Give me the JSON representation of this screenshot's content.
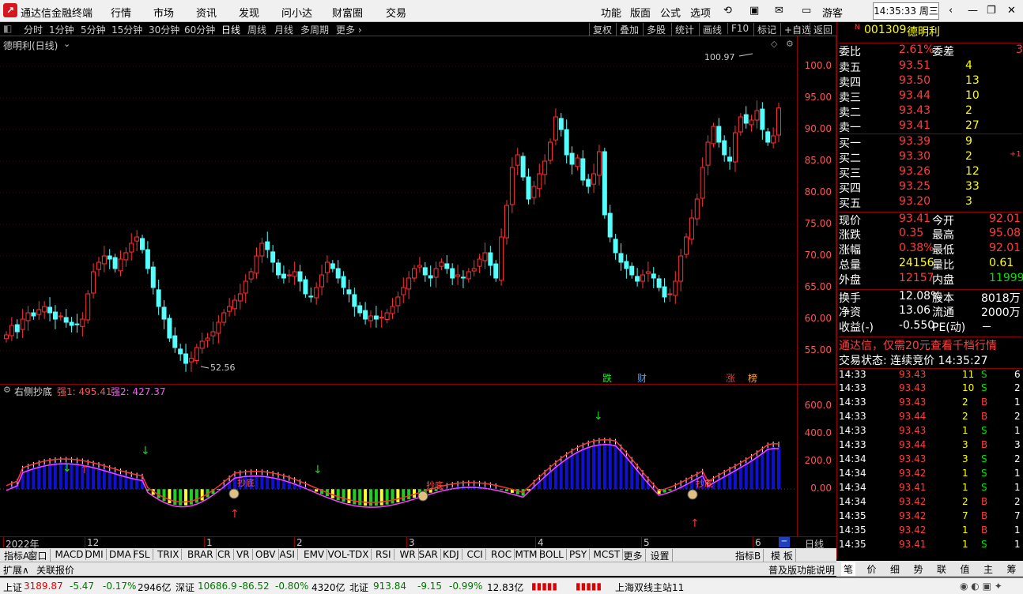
{
  "app": {
    "title": "通达信金融终端",
    "menus": [
      "行情",
      "市场",
      "资讯",
      "发现",
      "问小达",
      "财富圈",
      "交易"
    ],
    "right_menus": [
      "功能",
      "版面",
      "公式",
      "选项"
    ],
    "user": "游客",
    "clock": "14:35:33 周三"
  },
  "toolbar": {
    "periods": [
      "分时",
      "1分钟",
      "5分钟",
      "15分钟",
      "30分钟",
      "60分钟",
      "日线",
      "周线",
      "月线",
      "多周期",
      "更多 ›"
    ],
    "selected": "日线",
    "buttons": [
      "复权",
      "叠加",
      "多股",
      "统计",
      "画线",
      "F10",
      "标记",
      "+自选",
      "返回"
    ]
  },
  "main": {
    "label": "德明利(日线)",
    "high_label": "100.97",
    "low_label": "52.56",
    "yaxis": [
      "100.0",
      "95.00",
      "90.00",
      "85.00",
      "80.00",
      "75.00",
      "70.00",
      "65.00",
      "60.00",
      "55.00"
    ],
    "markers": [
      {
        "text": "跌",
        "color": "#00ff00"
      },
      {
        "text": "财",
        "color": "#4aa0ff"
      },
      {
        "text": "涨",
        "color": "#ff3030"
      },
      {
        "text": "榜",
        "color": "#ffa040"
      }
    ]
  },
  "sub": {
    "name": "右侧抄底",
    "s1_label": "强1: 495.41",
    "s2_label": "强2: 427.37",
    "yaxis": [
      "600.0",
      "400.0",
      "200.0",
      "0.00"
    ],
    "signals": [
      "抄底",
      "抄底",
      "抄底"
    ]
  },
  "xaxis": {
    "labels": [
      "2022年",
      "12",
      "1",
      "2",
      "3",
      "4",
      "5",
      "6"
    ],
    "period": "日线"
  },
  "tabs": [
    "指标A",
    "窗口",
    "MACD",
    "DMI",
    "DMA",
    "FSL",
    "TRIX",
    "BRAR",
    "CR",
    "VR",
    "OBV",
    "ASI",
    "EMV",
    "VOL-TDX",
    "RSI",
    "WR",
    "SAR",
    "KDJ",
    "CCI",
    "ROC",
    "MTM",
    "BOLL",
    "PSY",
    "MCST",
    "更多",
    "设置"
  ],
  "tabs_right": [
    "指标B",
    "模 板"
  ],
  "tabs2": {
    "expand": "扩展∧",
    "quotes": "关联报价",
    "version_notice": "普及版功能说明"
  },
  "quote": {
    "flag": "N",
    "code": "001309",
    "name": "德明利",
    "weibi_label": "委比",
    "weibi": "2.61%",
    "weicha_label": "委差",
    "weicha": "3",
    "asks": [
      {
        "l": "卖五",
        "p": "93.51",
        "v": "4"
      },
      {
        "l": "卖四",
        "p": "93.50",
        "v": "13"
      },
      {
        "l": "卖三",
        "p": "93.44",
        "v": "10"
      },
      {
        "l": "卖二",
        "p": "93.43",
        "v": "2"
      },
      {
        "l": "卖一",
        "p": "93.41",
        "v": "27"
      }
    ],
    "bids": [
      {
        "l": "买一",
        "p": "93.39",
        "v": "9",
        "c": ""
      },
      {
        "l": "买二",
        "p": "93.30",
        "v": "2",
        "c": "+1"
      },
      {
        "l": "买三",
        "p": "93.26",
        "v": "12",
        "c": ""
      },
      {
        "l": "买四",
        "p": "93.25",
        "v": "33",
        "c": ""
      },
      {
        "l": "买五",
        "p": "93.20",
        "v": "3",
        "c": ""
      }
    ],
    "stats": [
      [
        "现价",
        "93.41",
        "今开",
        "92.01"
      ],
      [
        "涨跌",
        "0.35",
        "最高",
        "95.08"
      ],
      [
        "涨幅",
        "0.38%",
        "最低",
        "92.01"
      ],
      [
        "总量",
        "24156",
        "量比",
        "0.61"
      ],
      [
        "外盘",
        "12157",
        "内盘",
        "11999"
      ]
    ],
    "fund": [
      [
        "换手",
        "12.08%",
        "股本",
        "8018万"
      ],
      [
        "净资",
        "13.06",
        "流通",
        "2000万"
      ],
      [
        "收益(-)",
        "-0.550",
        "PE(动)",
        "－"
      ]
    ],
    "ad": "通达信，仅需20元查看千档行情",
    "trade_state": "交易状态: 连续竞价 14:35:27",
    "ticks": [
      [
        "14:33",
        "93.43",
        "11",
        "S",
        "6"
      ],
      [
        "14:33",
        "93.43",
        "10",
        "S",
        "2"
      ],
      [
        "14:33",
        "93.43",
        "2",
        "B",
        "1"
      ],
      [
        "14:33",
        "93.44",
        "2",
        "B",
        "2"
      ],
      [
        "14:33",
        "93.43",
        "1",
        "S",
        "1"
      ],
      [
        "14:33",
        "93.44",
        "3",
        "B",
        "3"
      ],
      [
        "14:34",
        "93.43",
        "3",
        "S",
        "2"
      ],
      [
        "14:34",
        "93.42",
        "1",
        "S",
        "1"
      ],
      [
        "14:34",
        "93.41",
        "1",
        "S",
        "1"
      ],
      [
        "14:34",
        "93.42",
        "2",
        "B",
        "2"
      ],
      [
        "14:35",
        "93.42",
        "7",
        "B",
        "7"
      ],
      [
        "14:35",
        "93.42",
        "1",
        "B",
        "1"
      ],
      [
        "14:35",
        "93.41",
        "1",
        "S",
        "1"
      ]
    ],
    "rtabs": [
      "笔",
      "价",
      "细",
      "势",
      "联",
      "值",
      "主",
      "筹"
    ]
  },
  "status": {
    "sh_label": "上证",
    "sh": "3189.87",
    "sh_chg": "-5.47",
    "sh_pct": "-0.17%",
    "sh_amt": "2946亿",
    "sz_label": "深证",
    "sz": "10686.9",
    "sz_chg": "-86.52",
    "sz_pct": "-0.80%",
    "sz_amt": "4320亿",
    "bz_label": "北证",
    "bz": "913.84",
    "bz_chg": "-9.15",
    "bz_pct": "-0.99%",
    "bz_amt": "12.83亿",
    "server": "上海双线主站11"
  },
  "chart_data": {
    "type": "candlestick",
    "ylim": [
      51,
      101
    ],
    "closes": [
      57.5,
      59,
      58,
      60,
      61,
      60.5,
      61.5,
      62,
      61,
      60,
      60.5,
      59.5,
      59,
      59.2,
      60,
      64,
      67.5,
      69,
      70,
      69.5,
      68,
      69.5,
      70.5,
      72,
      73,
      71,
      68,
      65,
      62,
      60,
      57,
      55.5,
      54.5,
      53,
      53.8,
      55.5,
      56.5,
      57,
      58,
      59.5,
      61,
      62,
      63,
      64,
      66,
      67.5,
      70,
      72,
      71,
      69,
      67,
      66.5,
      67,
      67.5,
      66,
      64,
      63.5,
      65,
      67,
      69,
      68,
      66.5,
      65,
      64,
      62,
      61,
      60,
      60.5,
      60,
      60.3,
      61,
      62,
      63.5,
      65,
      66.5,
      68,
      68.5,
      67,
      66.5,
      68,
      69,
      68,
      66.5,
      67,
      66.5,
      67.5,
      68,
      69.5,
      70.5,
      68.5,
      66.5,
      73,
      78,
      84,
      86,
      82.5,
      79,
      81,
      83,
      85,
      88,
      92,
      90,
      86,
      84.5,
      85.5,
      82,
      81,
      83,
      86.5,
      76.5,
      73,
      70.5,
      69,
      68,
      67,
      66,
      67,
      67.5,
      66.5,
      65,
      63.5,
      64,
      66,
      70,
      73,
      76,
      79,
      84,
      88,
      90.5,
      88,
      86,
      85,
      89.5,
      92,
      91,
      91.5,
      93,
      90,
      88,
      89,
      93.41
    ],
    "strong1": [
      495.41
    ],
    "strong2": [
      427.37
    ]
  }
}
